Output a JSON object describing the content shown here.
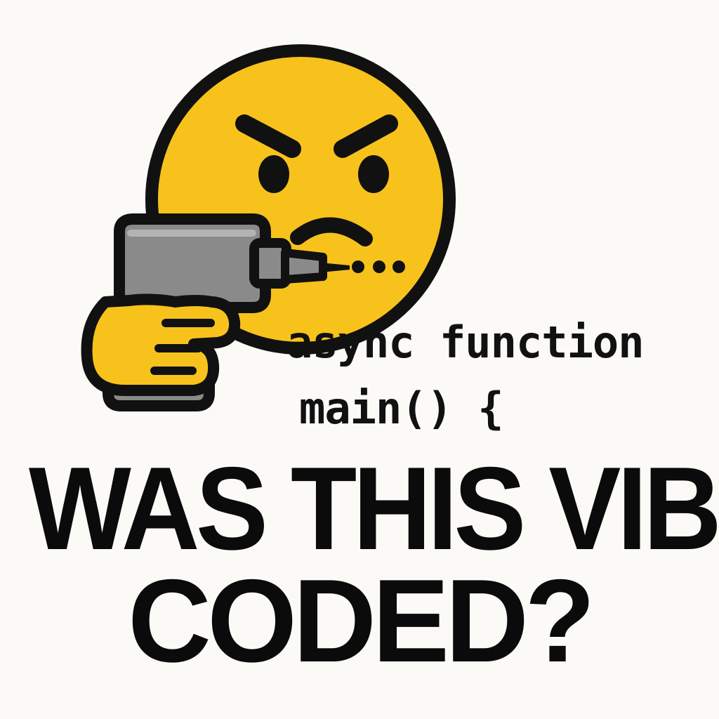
{
  "code": {
    "line1": "async function",
    "line2": "main() {"
  },
  "headline": {
    "line1": "WAS THIS VIBE",
    "line2": "CODED?"
  },
  "icons": {
    "face": "angry-face-icon",
    "drill": "power-drill-icon",
    "hand": "hand-icon"
  },
  "colors": {
    "background": "#fbfaf6",
    "face_yellow": "#f8c21c",
    "outline": "#111111",
    "drill_gray": "#8a8a8a",
    "text": "#0b0b0b"
  }
}
